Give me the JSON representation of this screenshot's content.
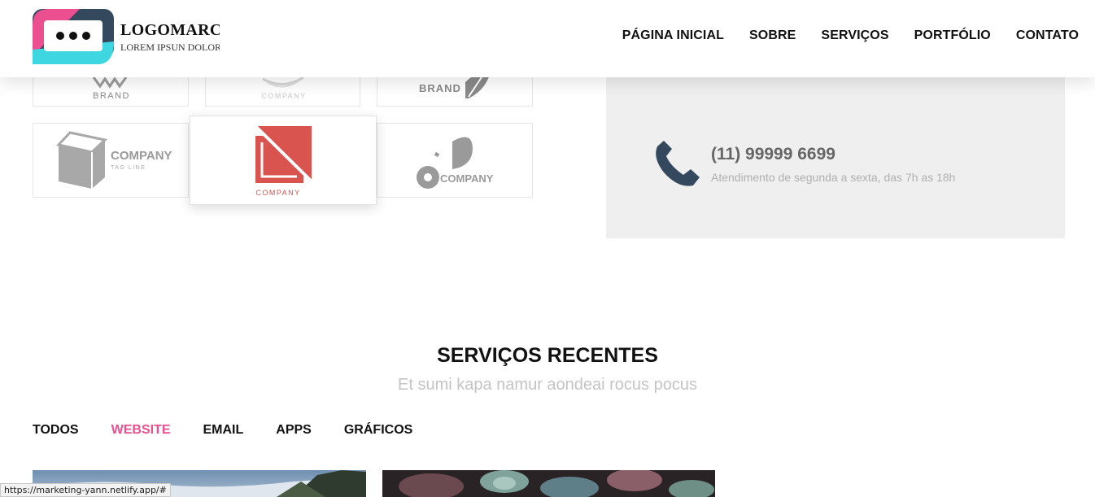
{
  "header": {
    "logo_title": "LOGOMARCA",
    "logo_subtitle": "LOREM IPSUN DOLOR",
    "nav": [
      "PÁGINA INICIAL",
      "SOBRE",
      "SERVIÇOS",
      "PORTFÓLIO",
      "CONTATO"
    ]
  },
  "brands": {
    "row1": [
      "BRAND",
      "COMPANY",
      "BRAND"
    ],
    "row2": [
      {
        "name": "COMPANY",
        "tagline": "TAG LINE"
      },
      {
        "name": "COMPANY"
      },
      {
        "name": "COMPANY"
      }
    ],
    "accent_color": "#d9534f"
  },
  "contact": {
    "phone": "(11) 99999 6699",
    "hours": "Atendimento de segunda a sexta, das 7h as 18h",
    "icon": "phone-icon",
    "icon_color": "#34495e"
  },
  "services": {
    "title": "SERVIÇOS RECENTES",
    "subtitle": "Et sumi kapa namur aondeai rocus pocus",
    "filters": [
      "TODOS",
      "WEBSITE",
      "EMAIL",
      "APPS",
      "GRÁFICOS"
    ],
    "active_filter": "WEBSITE",
    "active_color": "#ec4f8f"
  },
  "status_bar": {
    "url": "https://marketing-yann.netlify.app/#"
  }
}
